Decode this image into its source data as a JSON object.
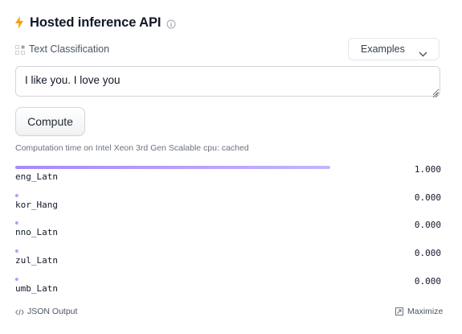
{
  "header": {
    "title": "Hosted inference API",
    "accent_color": "#f59e0b",
    "icons": [
      "bolt-icon",
      "info-icon"
    ]
  },
  "task": {
    "label": "Text Classification",
    "icon": "text-classification-icon"
  },
  "examples": {
    "label": "Examples",
    "icon": "chevron-down-icon"
  },
  "input": {
    "value": "I like you. I love you"
  },
  "compute": {
    "label": "Compute"
  },
  "computation_time": "Computation time on Intel Xeon 3rd Gen Scalable cpu: cached",
  "results": [
    {
      "label": "eng_Latn",
      "score": "1.000",
      "fraction": 1.0
    },
    {
      "label": "kor_Hang",
      "score": "0.000",
      "fraction": 0.0
    },
    {
      "label": "nno_Latn",
      "score": "0.000",
      "fraction": 0.0
    },
    {
      "label": "zul_Latn",
      "score": "0.000",
      "fraction": 0.0
    },
    {
      "label": "umb_Latn",
      "score": "0.000",
      "fraction": 0.0
    }
  ],
  "bar_color": "#a78bfa",
  "footer": {
    "json_output_label": "JSON Output",
    "maximize_label": "Maximize"
  }
}
